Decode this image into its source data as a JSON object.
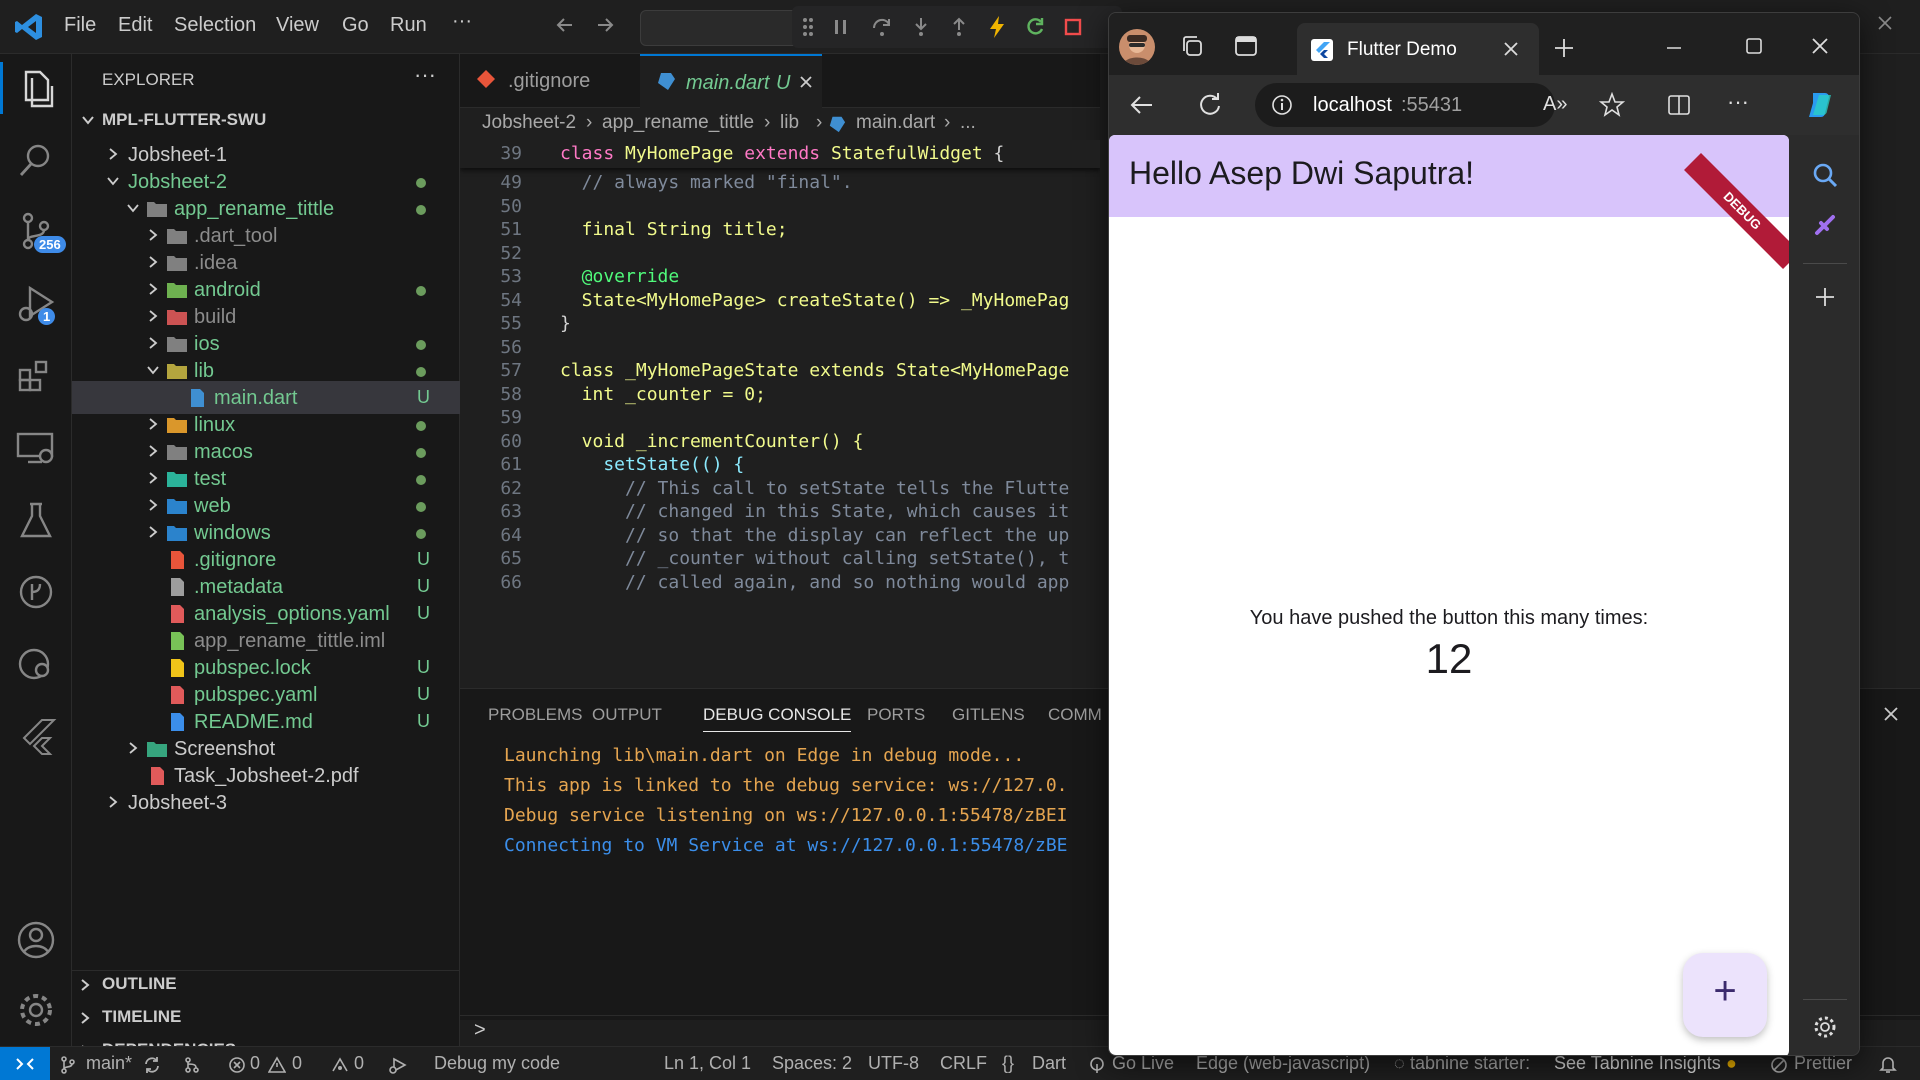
{
  "titlebar": {
    "menu": [
      "File",
      "Edit",
      "Selection",
      "View",
      "Go",
      "Run"
    ],
    "more": "···"
  },
  "activity": {
    "scm_badge": "256",
    "debug_badge": "1"
  },
  "sidebar": {
    "title": "EXPLORER",
    "more": "···",
    "root": "MPL-FLUTTER-SWU",
    "items": [
      {
        "label": "Jobsheet-1",
        "depth": 1,
        "kind": "folder",
        "open": false,
        "status": ""
      },
      {
        "label": "Jobsheet-2",
        "depth": 1,
        "kind": "folder",
        "open": true,
        "status": "dot",
        "color": "#73c991"
      },
      {
        "label": "app_rename_tittle",
        "depth": 2,
        "kind": "folder",
        "open": true,
        "status": "dot",
        "color": "#73c991"
      },
      {
        "label": ".dart_tool",
        "depth": 3,
        "kind": "folder",
        "open": false,
        "status": "",
        "color": "#8c8c8c"
      },
      {
        "label": ".idea",
        "depth": 3,
        "kind": "folder",
        "open": false,
        "status": "",
        "color": "#8c8c8c"
      },
      {
        "label": "android",
        "depth": 3,
        "kind": "folder",
        "open": false,
        "status": "dot",
        "color": "#73c991"
      },
      {
        "label": "build",
        "depth": 3,
        "kind": "folder",
        "open": false,
        "status": "",
        "color": "#8c8c8c"
      },
      {
        "label": "ios",
        "depth": 3,
        "kind": "folder",
        "open": false,
        "status": "dot",
        "color": "#73c991"
      },
      {
        "label": "lib",
        "depth": 3,
        "kind": "folder",
        "open": true,
        "status": "dot",
        "color": "#73c991"
      },
      {
        "label": "main.dart",
        "depth": 4,
        "kind": "file",
        "status": "U",
        "color": "#73c991",
        "selected": true
      },
      {
        "label": "linux",
        "depth": 3,
        "kind": "folder",
        "open": false,
        "status": "dot",
        "color": "#73c991"
      },
      {
        "label": "macos",
        "depth": 3,
        "kind": "folder",
        "open": false,
        "status": "dot",
        "color": "#73c991"
      },
      {
        "label": "test",
        "depth": 3,
        "kind": "folder",
        "open": false,
        "status": "dot",
        "color": "#73c991"
      },
      {
        "label": "web",
        "depth": 3,
        "kind": "folder",
        "open": false,
        "status": "dot",
        "color": "#73c991"
      },
      {
        "label": "windows",
        "depth": 3,
        "kind": "folder",
        "open": false,
        "status": "dot",
        "color": "#73c991"
      },
      {
        "label": ".gitignore",
        "depth": 3,
        "kind": "file",
        "status": "U",
        "color": "#73c991"
      },
      {
        "label": ".metadata",
        "depth": 3,
        "kind": "file",
        "status": "U",
        "color": "#73c991"
      },
      {
        "label": "analysis_options.yaml",
        "depth": 3,
        "kind": "file",
        "status": "U",
        "color": "#73c991"
      },
      {
        "label": "app_rename_tittle.iml",
        "depth": 3,
        "kind": "file",
        "status": "",
        "color": "#8c8c8c"
      },
      {
        "label": "pubspec.lock",
        "depth": 3,
        "kind": "file",
        "status": "U",
        "color": "#73c991"
      },
      {
        "label": "pubspec.yaml",
        "depth": 3,
        "kind": "file",
        "status": "U",
        "color": "#73c991"
      },
      {
        "label": "README.md",
        "depth": 3,
        "kind": "file",
        "status": "U",
        "color": "#73c991"
      },
      {
        "label": "Screenshot",
        "depth": 2,
        "kind": "folder",
        "open": false,
        "status": "",
        "color": "#cccccc"
      },
      {
        "label": "Task_Jobsheet-2.pdf",
        "depth": 2,
        "kind": "file",
        "status": "",
        "color": "#cccccc"
      },
      {
        "label": "Jobsheet-3",
        "depth": 1,
        "kind": "folder",
        "open": false,
        "status": "",
        "color": "#cccccc"
      }
    ],
    "sections": [
      "OUTLINE",
      "TIMELINE",
      "DEPENDENCIES"
    ]
  },
  "editor": {
    "tabs": [
      {
        "label": ".gitignore",
        "active": false
      },
      {
        "label": "main.dart",
        "status": "U",
        "active": true
      }
    ],
    "breadcrumb": [
      "Jobsheet-2",
      "app_rename_tittle",
      "lib",
      "main.dart",
      "..."
    ],
    "sticky_line": "39",
    "sticky_code": "class MyHomePage extends StatefulWidget {",
    "lines": [
      {
        "n": "49",
        "code": "  // always marked \"final\"."
      },
      {
        "n": "50",
        "code": ""
      },
      {
        "n": "51",
        "code": "  final String title;"
      },
      {
        "n": "52",
        "code": ""
      },
      {
        "n": "53",
        "code": "  @override"
      },
      {
        "n": "54",
        "code": "  State<MyHomePage> createState() => _MyHomePag"
      },
      {
        "n": "55",
        "code": "}"
      },
      {
        "n": "56",
        "code": ""
      },
      {
        "n": "57",
        "code": "class _MyHomePageState extends State<MyHomePage"
      },
      {
        "n": "58",
        "code": "  int _counter = 0;"
      },
      {
        "n": "59",
        "code": ""
      },
      {
        "n": "60",
        "code": "  void _incrementCounter() {"
      },
      {
        "n": "61",
        "code": "    setState(() {"
      },
      {
        "n": "62",
        "code": "      // This call to setState tells the Flutte"
      },
      {
        "n": "63",
        "code": "      // changed in this State, which causes it"
      },
      {
        "n": "64",
        "code": "      // so that the display can reflect the up"
      },
      {
        "n": "65",
        "code": "      // _counter without calling setState(), t"
      },
      {
        "n": "66",
        "code": "      // called again, and so nothing would app"
      }
    ]
  },
  "panel": {
    "tabs": [
      "PROBLEMS",
      "OUTPUT",
      "DEBUG CONSOLE",
      "PORTS",
      "GITLENS",
      "COMM"
    ],
    "active_tab": "DEBUG CONSOLE",
    "console": [
      {
        "text": "Launching lib\\main.dart on Edge in debug mode...",
        "color": "#e5a550"
      },
      {
        "text": "This app is linked to the debug service: ws://127.0.",
        "color": "#e5a550"
      },
      {
        "text": "Debug service listening on ws://127.0.0.1:55478/zBEI",
        "color": "#e5a550"
      },
      {
        "text": "Connecting to VM Service at ws://127.0.0.1:55478/zBE",
        "color": "#3b8eea"
      }
    ],
    "prompt": ">"
  },
  "statusbar": {
    "branch": "main*",
    "errors": "0",
    "warnings": "0",
    "ports": "0",
    "debug": "Debug my code",
    "position": "Ln 1, Col 1",
    "spaces": "Spaces: 2",
    "encoding": "UTF-8",
    "eol": "CRLF",
    "language": "Dart",
    "golive": "Go Live",
    "device": "Edge (web-javascript)",
    "tabnine": "tabnine starter:",
    "insights": "See Tabnine Insights",
    "prettier": "Prettier"
  },
  "browser": {
    "tab_title": "Flutter Demo",
    "url_host": "localhost",
    "url_port": ":55431",
    "reader": "A»",
    "more": "···"
  },
  "app": {
    "title": "Hello Asep Dwi Saputra!",
    "debug_banner": "DEBUG",
    "message": "You have pushed the button this many times:",
    "counter": "12",
    "fab": "+"
  },
  "colors": {
    "accent": "#0078d4",
    "appbar": "#d8c4fb",
    "fab": "#ece3fc",
    "debug_ribbon": "#b11b38"
  }
}
